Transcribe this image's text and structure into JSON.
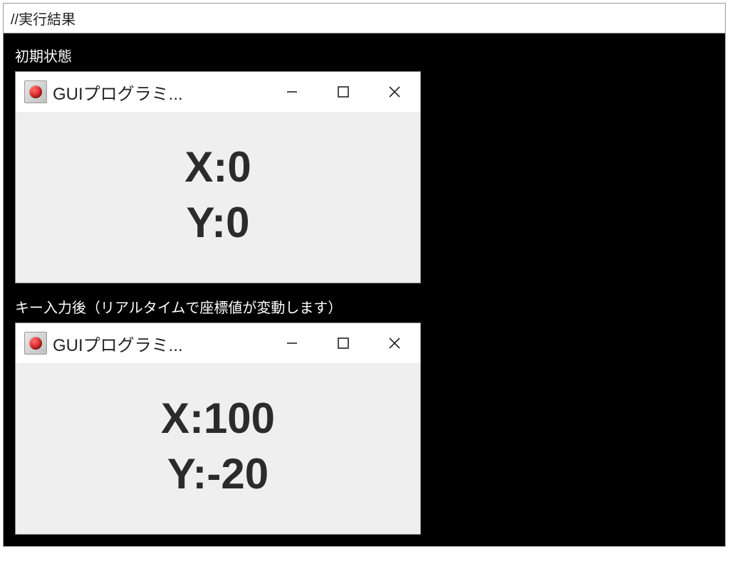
{
  "header": "//実行結果",
  "captions": {
    "initial": "初期状態",
    "after": "キー入力後（リアルタイムで座標値が変動します）"
  },
  "windows": {
    "initial": {
      "title": "GUIプログラミ...",
      "xline": "X:0",
      "yline": "Y:0"
    },
    "after": {
      "title": "GUIプログラミ...",
      "xline": "X:100",
      "yline": "Y:-20"
    }
  }
}
